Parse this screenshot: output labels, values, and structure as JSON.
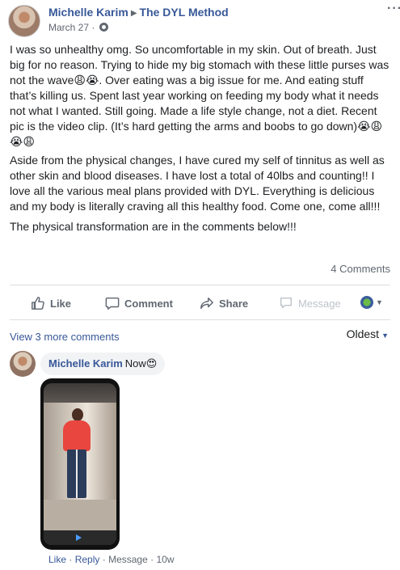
{
  "post": {
    "author": "Michelle Karim",
    "group": "The DYL Method",
    "date": "March 27 ·",
    "paragraphs": [
      "I was so unhealthy omg. So uncomfortable in my skin. Out of breath. Just big for no reason. Trying to hide my big stomach with these little purses was not the wave😩😭. Over eating was a big issue for me. And eating stuff that’s killing us. Spent last year working on feeding my body what it needs not what I wanted. Still going. Made a life style change, not a diet. Recent pic is the video clip. (It’s hard getting the arms and boobs to go down)😭😩😭😩",
      "Aside from the physical changes, I have cured my self of tinnitus as well as other skin and blood diseases. I have lost a total of 40lbs and counting!! I love all the various meal plans provided with DYL. Everything is delicious and my body is literally craving all this healthy food. Come one, come all!!!",
      "The physical transformation are in the comments below!!!"
    ],
    "comments_count": "4 Comments"
  },
  "actions": {
    "like": "Like",
    "comment": "Comment",
    "share": "Share",
    "message": "Message"
  },
  "comments": {
    "view_more": "View 3 more comments",
    "sort": "Oldest",
    "items": [
      {
        "author": "Michelle Karim",
        "text": "Now😍",
        "like": "Like",
        "reply": "Reply",
        "message": "Message",
        "time": "10w"
      }
    ]
  },
  "colors": {
    "link": "#385898",
    "meta": "#606770",
    "divider": "#dadde1",
    "bubble": "#f2f3f5"
  },
  "icons": [
    "globe-icon",
    "more-icon",
    "like-icon",
    "comment-icon",
    "share-icon",
    "message-icon",
    "audience-icon",
    "chevron-down-icon"
  ]
}
